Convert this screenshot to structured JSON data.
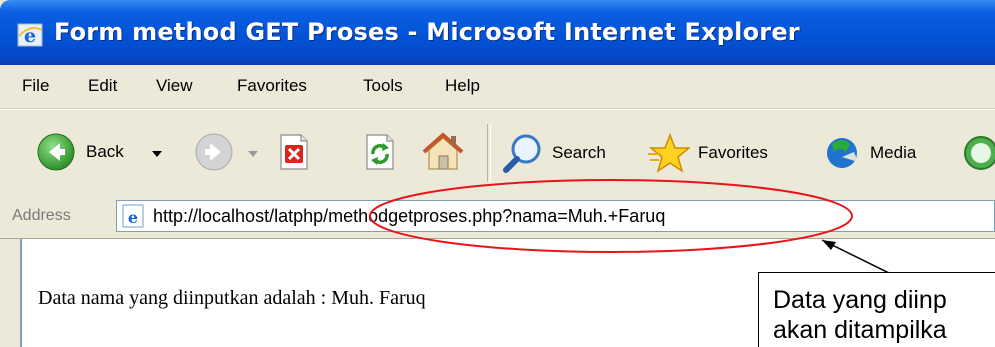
{
  "window": {
    "title": "Form method GET Proses - Microsoft Internet Explorer"
  },
  "menu": [
    "File",
    "Edit",
    "View",
    "Favorites",
    "Tools",
    "Help"
  ],
  "toolbar": {
    "back_label": "Back",
    "search_label": "Search",
    "favorites_label": "Favorites",
    "media_label": "Media"
  },
  "address": {
    "label": "Address",
    "url": "http://localhost/latphp/methodgetproses.php?nama=Muh.+Faruq"
  },
  "content": {
    "text": "Data nama yang diinputkan adalah : Muh. Faruq"
  },
  "annotation": {
    "callout_line1": "Data yang diinp",
    "callout_line2": "akan ditampilka",
    "ellipse_color": "#e8141a"
  },
  "colors": {
    "titlebar": "#0455d8",
    "chrome": "#ece9d8",
    "back_icon": "#3aa33a",
    "stop_icon": "#d8261c"
  },
  "icons": [
    "ie-logo-icon",
    "back-arrow-icon",
    "forward-arrow-icon",
    "stop-icon",
    "refresh-icon",
    "home-icon",
    "search-magnifier-icon",
    "favorites-star-icon",
    "media-icon",
    "history-icon",
    "page-favicon-icon"
  ]
}
